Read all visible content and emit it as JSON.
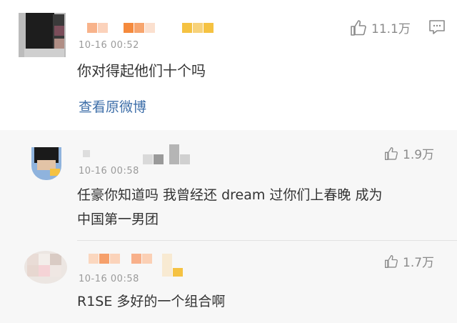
{
  "top_comment": {
    "time": "10-16 00:52",
    "text": "你对得起他们十个吗",
    "likes": "11.1万",
    "view_original": "查看原微博"
  },
  "replies": [
    {
      "time": "10-16 00:58",
      "text_line1": "任豪你知道吗 我曾经还 dream 过你们上春晚 成为",
      "text_line2": "中国第一男团",
      "likes": "1.9万"
    },
    {
      "time": "10-16 00:58",
      "text": "R1SE 多好的一个组合啊",
      "likes": "1.7万"
    }
  ],
  "colors": {
    "link": "#3d6ea8",
    "accent_orange": "#f58a3d",
    "accent_yellow": "#f5c242"
  },
  "icons": [
    "thumbs-up-icon",
    "comment-icon"
  ]
}
